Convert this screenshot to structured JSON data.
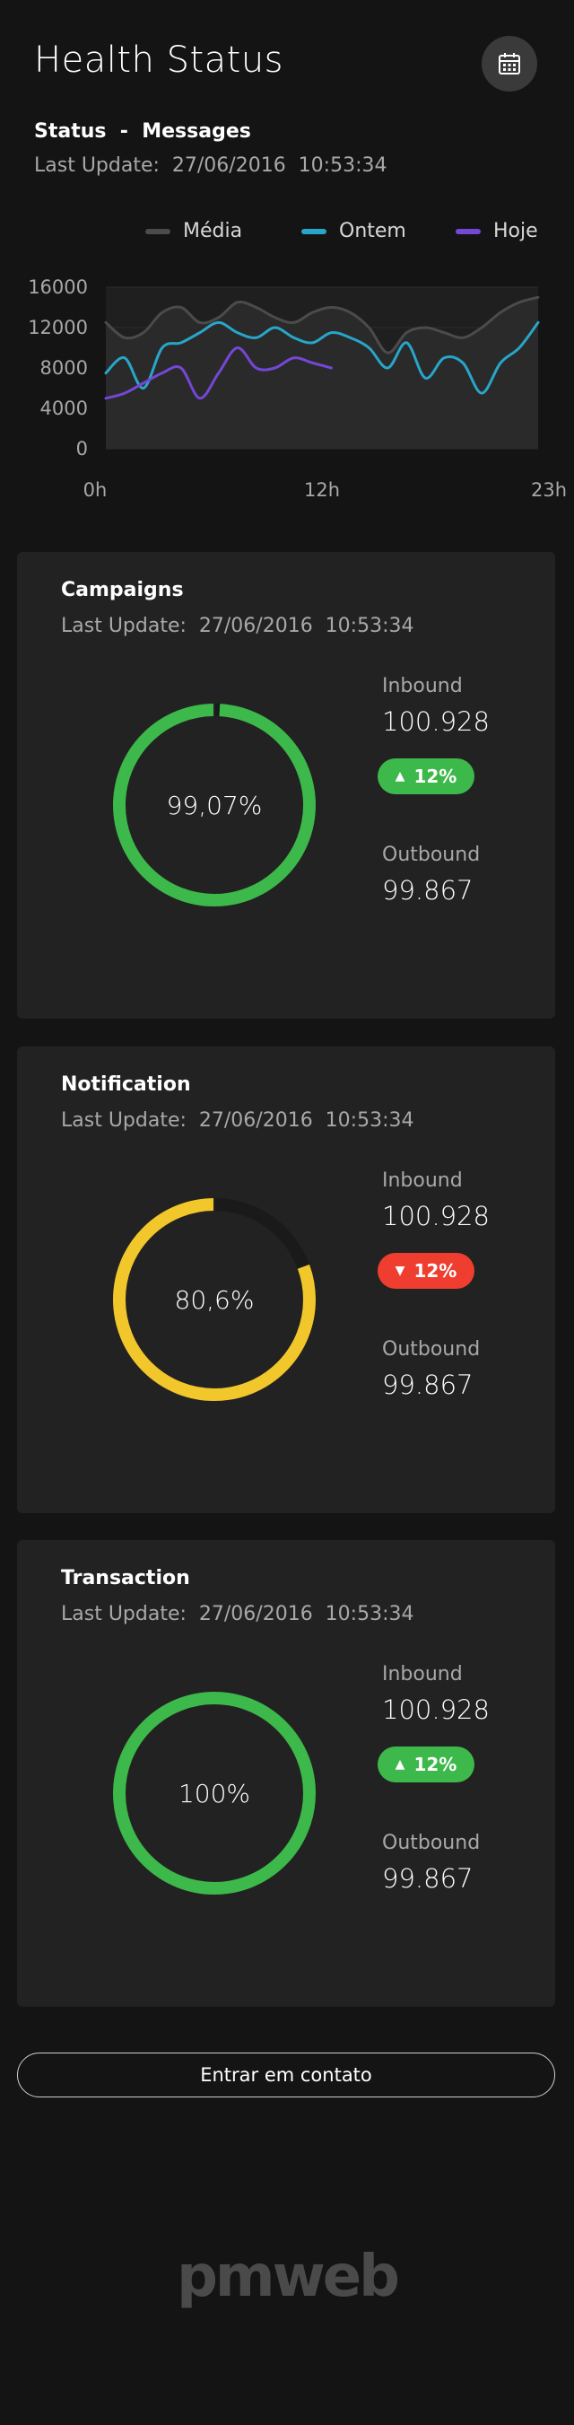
{
  "header": {
    "title": "Health Status",
    "calendar_icon": "calendar-icon",
    "subtitle": "Status  -  Messages",
    "last_update": "Last Update:  27/06/2016  10:53:34"
  },
  "colors": {
    "background": "#141414",
    "card": "#222222",
    "green": "#3db84a",
    "yellow": "#f2c72b",
    "red": "#ef3e2f",
    "media": "#4b4b4b",
    "ontem": "#27a6c9",
    "hoje": "#7447d6"
  },
  "chart_data": {
    "type": "line",
    "x": [
      0,
      1,
      2,
      3,
      4,
      5,
      6,
      7,
      8,
      9,
      10,
      11,
      12,
      13,
      14,
      15,
      16,
      17,
      18,
      19,
      20,
      21,
      22,
      23
    ],
    "x_ticks": [
      "0h",
      "12h",
      "23h"
    ],
    "y_ticks": [
      "16000",
      "12000",
      "8000",
      "4000",
      "0"
    ],
    "ylim": [
      0,
      16000
    ],
    "grid": true,
    "legend_position": "top-right",
    "series": [
      {
        "name": "Média",
        "color": "#4b4b4b",
        "area": true,
        "values": [
          12500,
          11000,
          11500,
          13500,
          14000,
          12500,
          13000,
          14500,
          14000,
          13000,
          12500,
          13500,
          14000,
          13500,
          12000,
          9500,
          11500,
          12000,
          11500,
          11000,
          12000,
          13500,
          14500,
          15000
        ]
      },
      {
        "name": "Ontem",
        "color": "#27a6c9",
        "area": false,
        "values": [
          7500,
          9000,
          6000,
          10000,
          10500,
          11500,
          12500,
          11500,
          11000,
          12000,
          11000,
          10500,
          11500,
          11000,
          10000,
          8000,
          10500,
          7000,
          9000,
          8500,
          5500,
          8500,
          10000,
          12500
        ]
      },
      {
        "name": "Hoje",
        "color": "#7447d6",
        "area": false,
        "values": [
          5000,
          5500,
          6500,
          7500,
          8000,
          5000,
          7500,
          10000,
          8000,
          8000,
          9000,
          8500,
          8000
        ]
      }
    ]
  },
  "cards": [
    {
      "title": "Campaigns",
      "last_update": "Last Update:  27/06/2016  10:53:34",
      "percent": 99.07,
      "percent_label": "99,07%",
      "color": "#3db84a",
      "inbound_label": "Inbound",
      "inbound_value": "100.928",
      "badge": "12%",
      "badge_direction": "up",
      "badge_color": "#3db84a",
      "outbound_label": "Outbound",
      "outbound_value": "99.867"
    },
    {
      "title": "Notification",
      "last_update": "Last Update:  27/06/2016  10:53:34",
      "percent": 80.6,
      "percent_label": "80,6%",
      "color": "#f2c72b",
      "inbound_label": "Inbound",
      "inbound_value": "100.928",
      "badge": "12%",
      "badge_direction": "down",
      "badge_color": "#ef3e2f",
      "outbound_label": "Outbound",
      "outbound_value": "99.867"
    },
    {
      "title": "Transaction",
      "last_update": "Last Update:  27/06/2016  10:53:34",
      "percent": 100,
      "percent_label": "100%",
      "color": "#3db84a",
      "inbound_label": "Inbound",
      "inbound_value": "100.928",
      "badge": "12%",
      "badge_direction": "up",
      "badge_color": "#3db84a",
      "outbound_label": "Outbound",
      "outbound_value": "99.867"
    }
  ],
  "contact_button": "Entrar em contato",
  "footer": {
    "logo": "pmweb"
  }
}
